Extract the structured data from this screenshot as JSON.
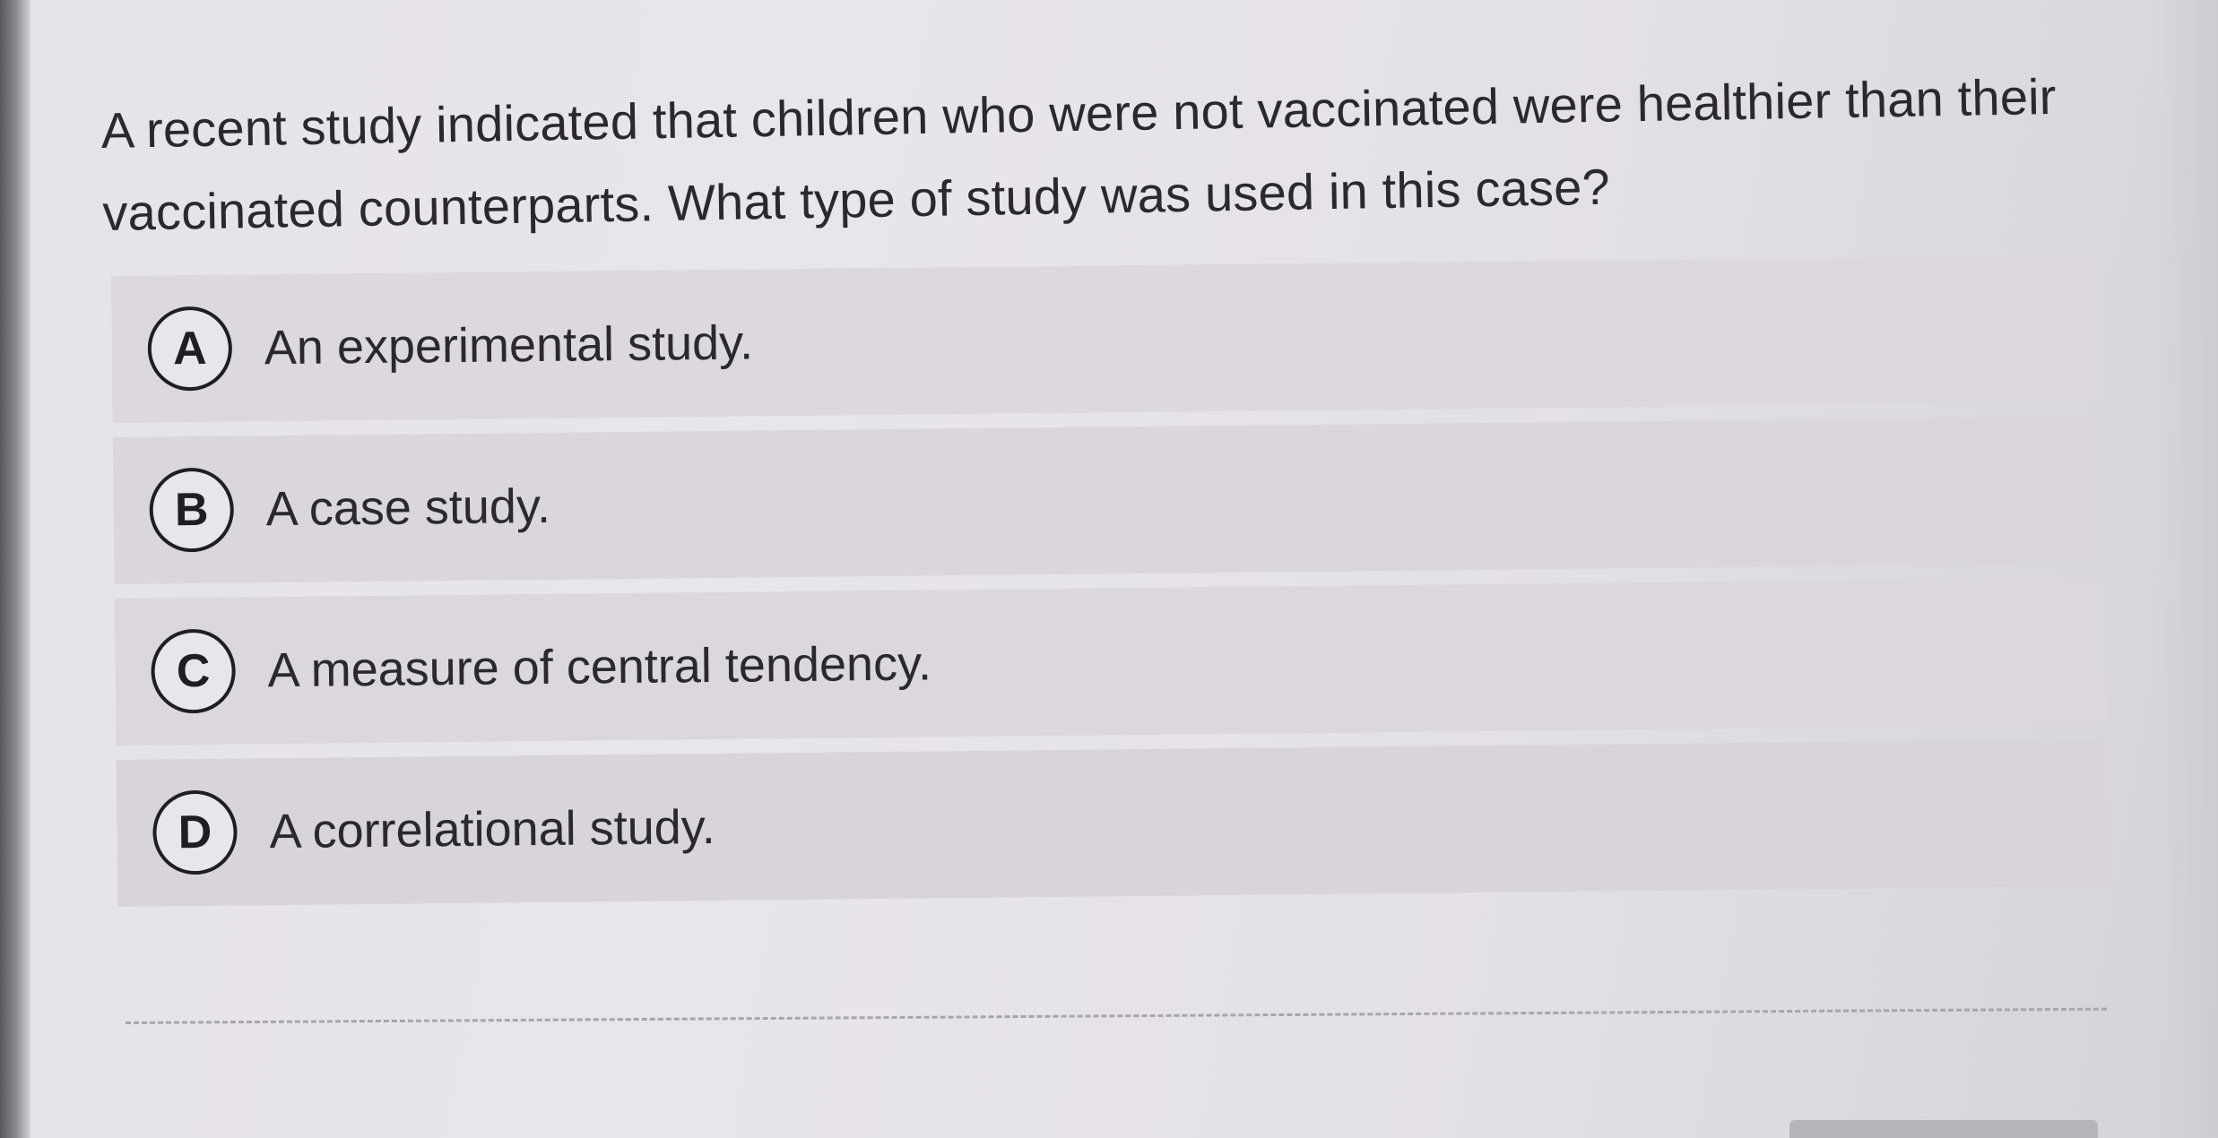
{
  "question": {
    "text": "A recent study indicated that children who were not vaccinated were healthier than their vaccinated counterparts. What type of study was used in this case?"
  },
  "options": [
    {
      "letter": "A",
      "label": "An experimental study."
    },
    {
      "letter": "B",
      "label": "A case study."
    },
    {
      "letter": "C",
      "label": "A measure of central tendency."
    },
    {
      "letter": "D",
      "label": "A correlational study."
    }
  ]
}
